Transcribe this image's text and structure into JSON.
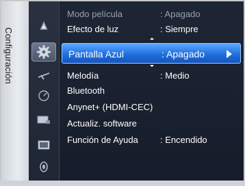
{
  "sidebar": {
    "title": "Configuración",
    "icons": [
      {
        "name": "picture-icon"
      },
      {
        "name": "setup-gear-icon"
      },
      {
        "name": "channel-icon"
      },
      {
        "name": "sound-icon"
      },
      {
        "name": "input-icon"
      },
      {
        "name": "application-icon"
      },
      {
        "name": "support-icon"
      }
    ]
  },
  "menu": {
    "items": [
      {
        "label": "Modo película",
        "value": ": Apagado",
        "state": "dimmed"
      },
      {
        "label": "Efecto de luz",
        "value": ": Siempre"
      },
      {
        "label": "Pantalla Azul",
        "value": ": Apagado",
        "state": "selected"
      },
      {
        "label": "Melodía",
        "value": ": Medio"
      },
      {
        "label": "Bluetooth",
        "value": ""
      },
      {
        "label": "Anynet+ (HDMI-CEC)",
        "value": ""
      },
      {
        "label": "Actualiz. software",
        "value": ""
      },
      {
        "label": "Función de Ayuda",
        "value": ": Encendido"
      }
    ]
  },
  "colors": {
    "highlight": "#1f6fe0",
    "menu_bg": "#161c2a",
    "sidebar_tab": "#e9ecf0"
  }
}
